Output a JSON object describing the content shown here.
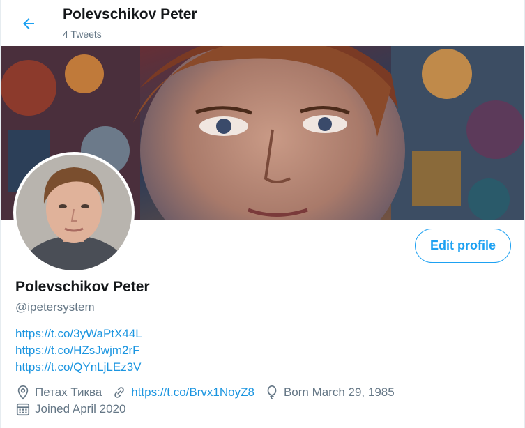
{
  "header": {
    "title": "Polevschikov Peter",
    "tweets_count": "4 Tweets",
    "back_icon": "arrow-left-icon"
  },
  "accent_color": "#1da1f2",
  "profile": {
    "name": "Polevschikov Peter",
    "handle": "@ipetersystem",
    "edit_button": "Edit profile",
    "bio_links": [
      "https://t.co/3yWaPtX44L",
      "https://t.co/HZsJwjm2rF",
      "https://t.co/QYnLjLEz3V"
    ],
    "location": "Петах Тиква",
    "website": "https://t.co/Brvx1NoyZ8",
    "birthday": "Born March 29, 1985",
    "joined": "Joined April 2020"
  }
}
